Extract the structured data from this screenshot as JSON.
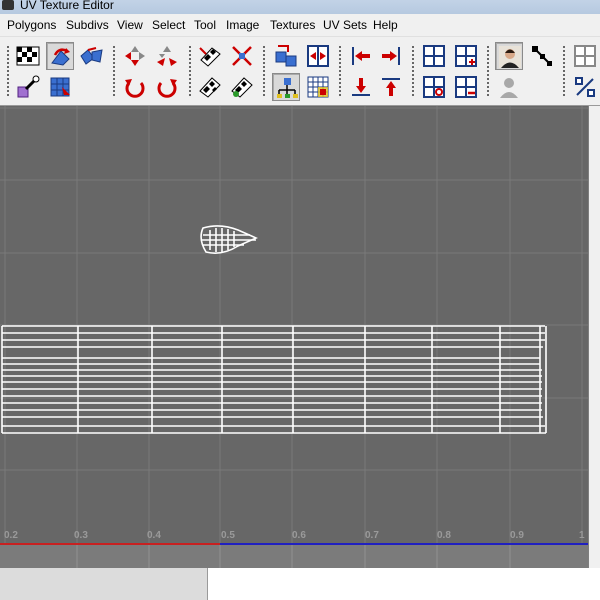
{
  "window": {
    "title": "UV Texture Editor"
  },
  "menu": [
    "Polygons",
    "Subdivs",
    "View",
    "Select",
    "Tool",
    "Image",
    "Textures",
    "UV Sets",
    "Help"
  ],
  "toolbar": {
    "buttons": [
      {
        "name": "checker-pattern-button",
        "icon": "checker-icon"
      },
      {
        "name": "flip-uv-button",
        "icon": "flip-icon"
      },
      {
        "name": "rotate-shell-button",
        "icon": "rotate-shell-icon"
      },
      {
        "name": "move-uv-button",
        "icon": "move-arrows-icon"
      },
      {
        "name": "scale-uv-button",
        "icon": "scale-arrows-icon"
      },
      {
        "name": "unfold-button",
        "icon": "unfold-icon"
      },
      {
        "name": "gather-button",
        "icon": "gather-icon"
      },
      {
        "name": "cut-uv-button",
        "icon": "cut-icon"
      },
      {
        "name": "sew-uv-button",
        "icon": "sew-icon"
      },
      {
        "name": "align-left-button",
        "icon": "arrow-left-icon"
      },
      {
        "name": "align-right-button",
        "icon": "arrow-right-icon"
      },
      {
        "name": "grid-add-button",
        "icon": "grid-icon"
      },
      {
        "name": "grid-plus-button",
        "icon": "grid-plus-icon"
      },
      {
        "name": "texture-display-button",
        "icon": "person-icon"
      },
      {
        "name": "snap-button",
        "icon": "snap-icon"
      },
      {
        "name": "grid-partial-button",
        "icon": "grid-icon"
      },
      {
        "name": "select-shell-button",
        "icon": "pick-icon"
      },
      {
        "name": "layout-uv-button",
        "icon": "layout-icon"
      },
      {
        "name": "rotate-ccw-button",
        "icon": "rotate-ccw-icon"
      },
      {
        "name": "rotate-cw-button",
        "icon": "rotate-cw-icon"
      },
      {
        "name": "checker-uv-button",
        "icon": "checker-icon"
      },
      {
        "name": "checker-edit-button",
        "icon": "checker-edit-icon"
      },
      {
        "name": "shell-select-button",
        "icon": "shell-icon"
      },
      {
        "name": "uv-grid-button",
        "icon": "uv-grid-icon"
      },
      {
        "name": "align-bottom-button",
        "icon": "arrow-down-icon"
      },
      {
        "name": "align-top-button",
        "icon": "arrow-up-icon"
      },
      {
        "name": "grid-dot-button",
        "icon": "grid-dot-icon"
      },
      {
        "name": "grid-minus-button",
        "icon": "grid-minus-icon"
      },
      {
        "name": "person-gray-button",
        "icon": "person-gray-icon"
      },
      {
        "name": "percent-button",
        "icon": "percent-icon"
      }
    ]
  },
  "viewport": {
    "tick_labels": [
      "0.2",
      "0.3",
      "0.4",
      "0.5",
      "0.6",
      "0.7",
      "0.8",
      "0.9",
      "1"
    ]
  }
}
